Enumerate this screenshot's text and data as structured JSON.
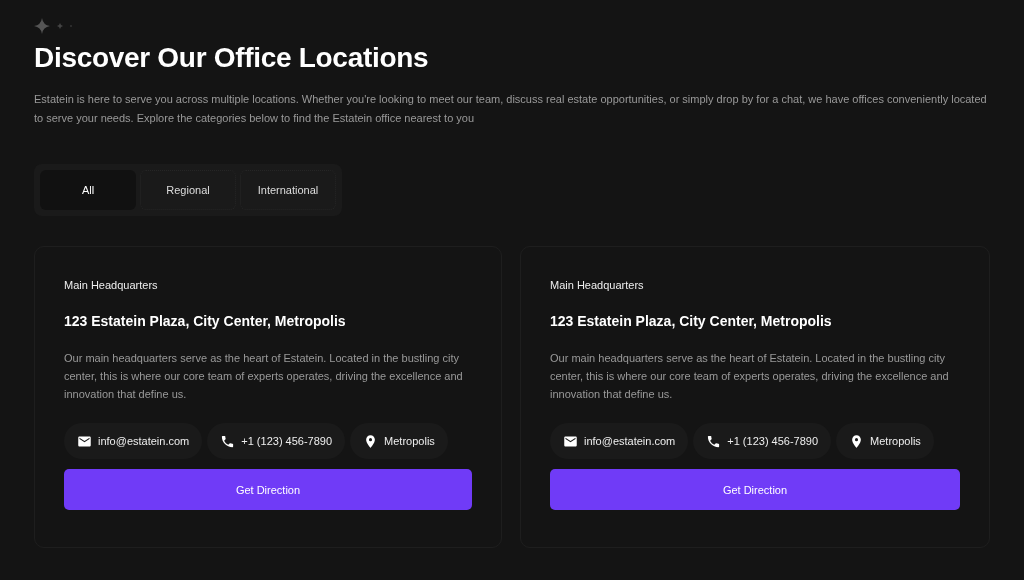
{
  "header": {
    "title": "Discover Our Office Locations",
    "description": "Estatein is here to serve you across multiple locations. Whether you're looking to meet our team, discuss real estate opportunities, or simply drop by for a chat, we have offices conveniently located to serve your needs. Explore the categories below to find the Estatein office nearest to you"
  },
  "tabs": [
    {
      "label": "All",
      "selected": true
    },
    {
      "label": "Regional",
      "selected": false
    },
    {
      "label": "International",
      "selected": false
    }
  ],
  "offices": [
    {
      "category": "Main Headquarters",
      "address": "123 Estatein Plaza, City Center, Metropolis",
      "description": "Our main headquarters serve as the heart of Estatein. Located in the bustling city center, this is where our core team of experts operates, driving the excellence and innovation that define us.",
      "contacts": [
        {
          "kind": "email",
          "text": "info@estatein.com"
        },
        {
          "kind": "phone",
          "text": "+1 (123) 456-7890"
        },
        {
          "kind": "location",
          "text": "Metropolis"
        }
      ],
      "button": "Get Direction"
    },
    {
      "category": "Main Headquarters",
      "address": "123 Estatein Plaza, City Center, Metropolis",
      "description": "Our main headquarters serve as the heart of Estatein. Located in the bustling city center, this is where our core team of experts operates, driving the excellence and innovation that define us.",
      "contacts": [
        {
          "kind": "email",
          "text": "info@estatein.com"
        },
        {
          "kind": "phone",
          "text": "+1 (123) 456-7890"
        },
        {
          "kind": "location",
          "text": "Metropolis"
        }
      ],
      "button": "Get Direction"
    }
  ]
}
